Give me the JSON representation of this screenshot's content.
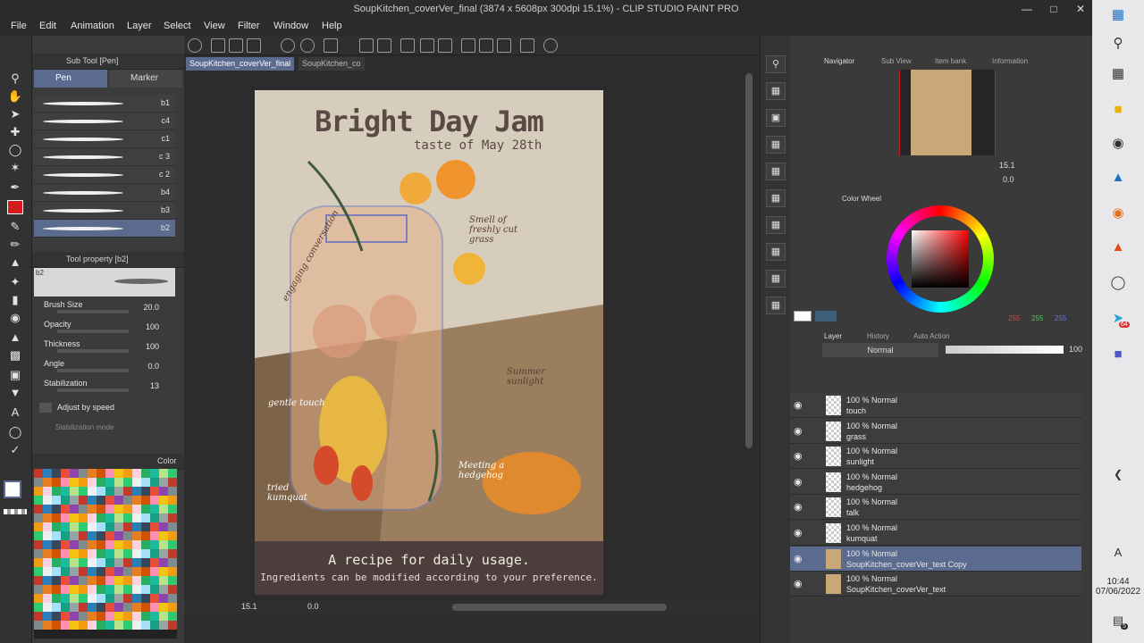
{
  "window": {
    "title": "SoupKitchen_coverVer_final (3874 x 5608px 300dpi 15.1%)  - CLIP STUDIO PAINT PRO"
  },
  "menu": [
    "File",
    "Edit",
    "Animation",
    "Layer",
    "Select",
    "View",
    "Filter",
    "Window",
    "Help"
  ],
  "subtool": {
    "header": "Sub Tool [Pen]",
    "tabs": [
      "Pen",
      "Marker"
    ],
    "brushes": [
      "b1",
      "c4",
      "c1",
      "c 3",
      "c 2",
      "b4",
      "b3",
      "b2"
    ],
    "selected": "b2"
  },
  "tool_property": {
    "header": "Tool property [b2]",
    "preview_label": "b2",
    "props": [
      {
        "label": "Brush Size",
        "value": "20.0"
      },
      {
        "label": "Opacity",
        "value": "100"
      },
      {
        "label": "Thickness",
        "value": "100"
      },
      {
        "label": "Angle",
        "value": "0.0"
      },
      {
        "label": "Stabilization",
        "value": "13"
      }
    ],
    "adjust_by_speed": "Adjust by speed",
    "stabilization_mode": "Stabilization mode"
  },
  "color_set": {
    "header": "Color"
  },
  "doc_tabs": [
    "SoupKitchen_coverVer_final",
    "SoupKitchen_co"
  ],
  "artwork": {
    "title": "Bright Day Jam",
    "subtitle": "taste of May 28th",
    "footer_line1": "A recipe for daily usage.",
    "footer_line2": "Ingredients can be modified according to your preference.",
    "notes": [
      "engaging conversation",
      "Smell of freshly cut grass",
      "Summer sunlight",
      "gentle touch",
      "Meeting a hedgehog",
      "tried kumquat"
    ]
  },
  "canvas_status": {
    "zoom": "15.1",
    "angle": "0.0"
  },
  "navigator": {
    "tabs": [
      "Navigator",
      "Sub View",
      "Item bank",
      "Information"
    ],
    "zoom": "15.1",
    "angle": "0.0"
  },
  "color_wheel": {
    "tab": "Color Wheel",
    "r": "255",
    "g": "255",
    "b": "255"
  },
  "layers": {
    "tabs": [
      "Layer",
      "History",
      "Auto Action"
    ],
    "blend_mode": "Normal",
    "opacity": "100",
    "items": [
      {
        "pct": "100 % Normal",
        "name": "touch"
      },
      {
        "pct": "100 % Normal",
        "name": "grass"
      },
      {
        "pct": "100 % Normal",
        "name": "sunlight"
      },
      {
        "pct": "100 % Normal",
        "name": "hedgehog"
      },
      {
        "pct": "100 % Normal",
        "name": "talk"
      },
      {
        "pct": "100 % Normal",
        "name": "kumquat"
      },
      {
        "pct": "100 % Normal",
        "name": "SoupKitchen_coverVer_text Copy"
      },
      {
        "pct": "100 % Normal",
        "name": "SoupKitchen_coverVer_text"
      }
    ]
  },
  "taskbar": {
    "time": "10:44",
    "date": "07/06/2022",
    "notifications": "5",
    "badge": "64"
  },
  "colors": {
    "accent": "#5b6b8f",
    "red_swatch": "#d41e1e"
  }
}
